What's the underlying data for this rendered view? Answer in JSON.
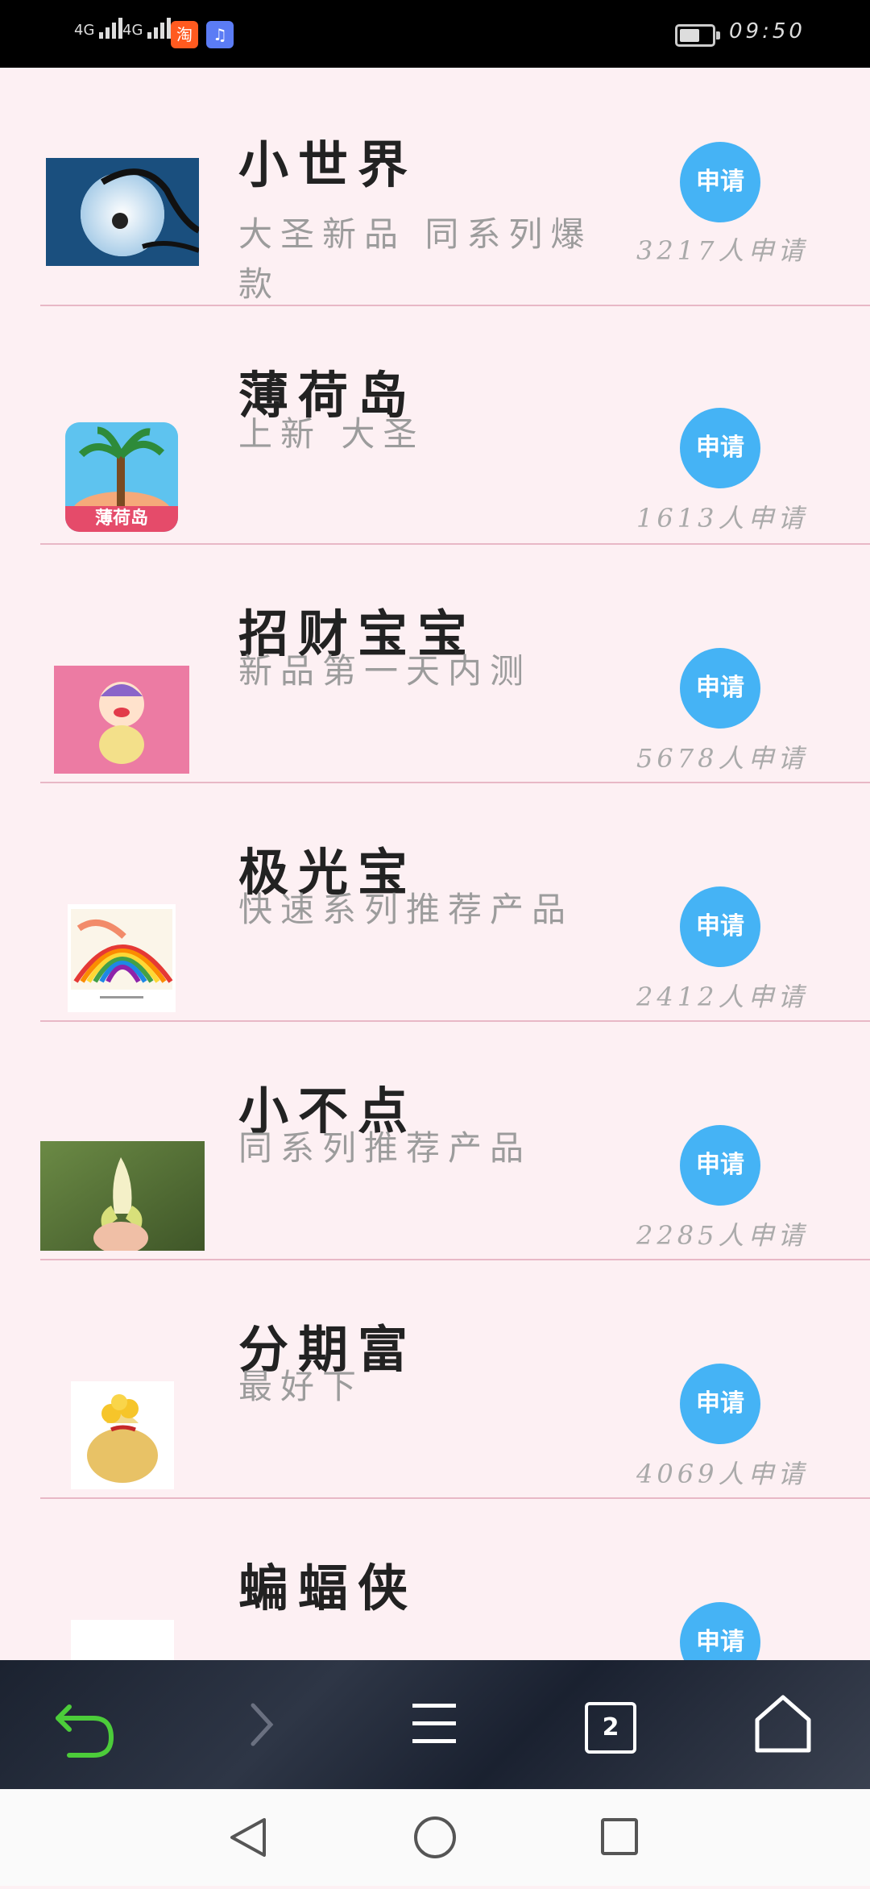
{
  "status_bar": {
    "signal1_label": "4G",
    "signal2_label": "4G",
    "app_badges": [
      {
        "label": "淘",
        "color": "#ff5a1f"
      },
      {
        "label": "♫",
        "color": "#5b7cf5"
      }
    ],
    "time": "09:50"
  },
  "items": [
    {
      "title": "小世界",
      "desc": "大圣新品 同系列爆款",
      "button": "申请",
      "count": "3217人申请"
    },
    {
      "title": "薄荷岛",
      "desc": "上新  大圣",
      "button": "申请",
      "count": "1613人申请"
    },
    {
      "title": "招财宝宝",
      "desc": "新品第一天内测",
      "button": "申请",
      "count": "5678人申请"
    },
    {
      "title": "极光宝",
      "desc": "快速系列推荐产品",
      "button": "申请",
      "count": "2412人申请"
    },
    {
      "title": "小不点",
      "desc": "同系列推荐产品",
      "button": "申请",
      "count": "2285人申请"
    },
    {
      "title": "分期富",
      "desc": "最好下",
      "button": "申请",
      "count": "4069人申请"
    },
    {
      "title": "蝙蝠侠",
      "desc": "",
      "button": "申请",
      "count": ""
    }
  ],
  "thumb_labels": {
    "mint_island_logo_text": "薄荷岛"
  },
  "toolbar": {
    "tab_count": "2"
  },
  "colors": {
    "accent": "#45b3f5",
    "background": "#fdf0f3",
    "divider": "#e8b8c6",
    "back_arrow": "#4ccc3a"
  }
}
